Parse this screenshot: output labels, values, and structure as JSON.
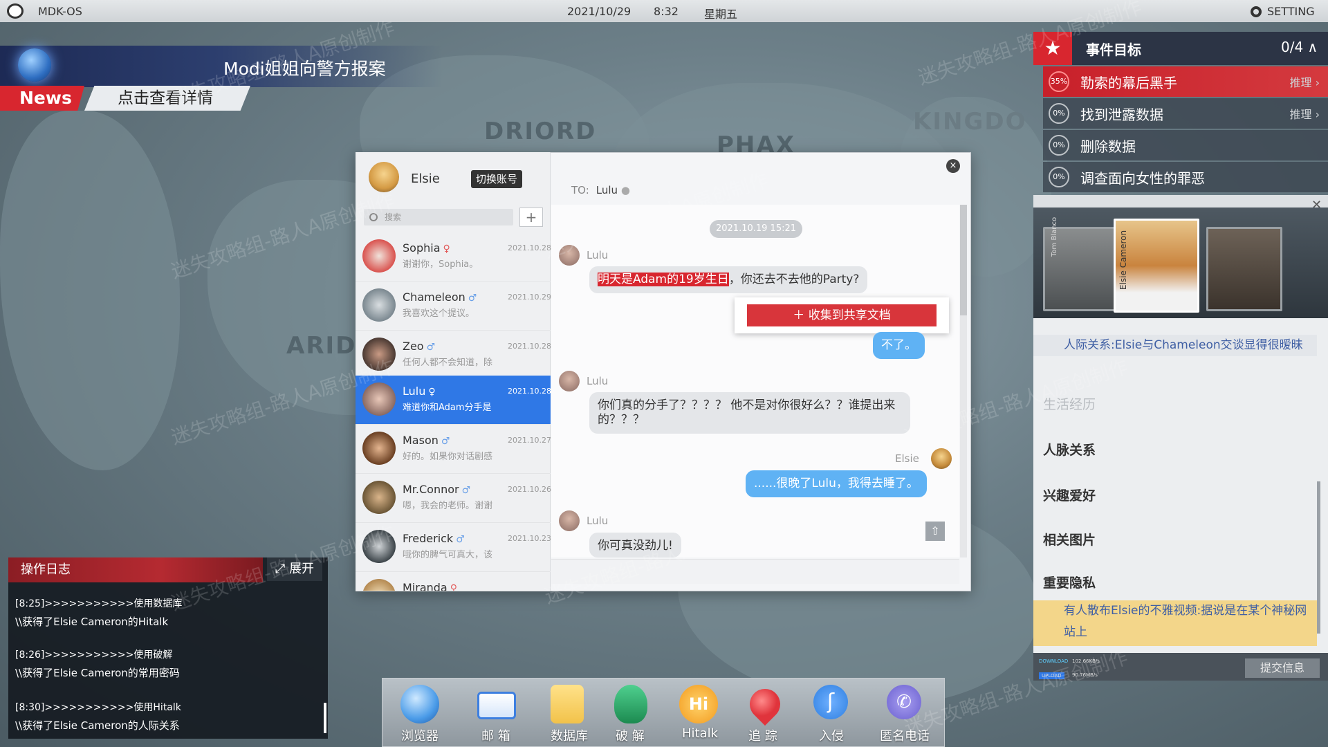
{
  "os": {
    "name": "MDK-OS",
    "date": "2021/10/29",
    "time": "8:32",
    "weekday": "星期五",
    "setting": "SETTING"
  },
  "map_labels": [
    "DRIORD",
    "PHAX",
    "ARID",
    "KINGDO"
  ],
  "watermark": "迷失攻略组-路人A原创制作",
  "news": {
    "headline": "Modi姐姐向警方报案",
    "tag": "News",
    "link": "点击查看详情"
  },
  "events": {
    "title": "事件目标",
    "count": "0/4",
    "items": [
      {
        "pct": "35%",
        "label": "勒索的幕后黑手",
        "action": "推理"
      },
      {
        "pct": "0%",
        "label": "找到泄露数据",
        "action": "推理"
      },
      {
        "pct": "0%",
        "label": "删除数据",
        "action": ""
      },
      {
        "pct": "0%",
        "label": "调查面向女性的罪恶",
        "action": ""
      }
    ]
  },
  "profile": {
    "card_names": [
      "Tom Blanco",
      "Elsie Cameron"
    ],
    "note1": "人际关系:Elsie与Chameleon交谈显得很暧昧",
    "sections": [
      "生活经历",
      "人脉关系",
      "兴趣爱好",
      "相关图片",
      "重要隐私"
    ],
    "note2": "有人散布Elsie的不雅视频:据说是在某个神秘网站上",
    "download": "DOWNLOAD",
    "upload": "UPLOAD",
    "download_speed": "102.66KB/s",
    "upload_speed": "90.76MB/s",
    "submit": "提交信息"
  },
  "chat": {
    "me": "Elsie",
    "switch_account": "切换账号",
    "search_placeholder": "搜索",
    "add": "+",
    "contacts": [
      {
        "name": "Sophia",
        "gender": "♀",
        "msg": "谢谢你，Sophia。",
        "date": "2021.10.28"
      },
      {
        "name": "Chameleon",
        "gender": "♂",
        "msg": "我喜欢这个提议。",
        "date": "2021.10.29"
      },
      {
        "name": "Zeo",
        "gender": "♂",
        "msg": "任何人都不会知道，除",
        "date": "2021.10.28"
      },
      {
        "name": "Lulu",
        "gender": "♀",
        "msg": "难道你和Adam分手是",
        "date": "2021.10.28"
      },
      {
        "name": "Mason",
        "gender": "♂",
        "msg": "好的。如果你对话剧感",
        "date": "2021.10.27"
      },
      {
        "name": "Mr.Connor",
        "gender": "♂",
        "msg": "嗯，我会的老师。谢谢",
        "date": "2021.10.26"
      },
      {
        "name": "Frederick",
        "gender": "♂",
        "msg": "哦你的脾气可真大，该",
        "date": "2021.10.23"
      },
      {
        "name": "Miranda",
        "gender": "♀",
        "msg": "",
        "date": ""
      }
    ],
    "to_label": "TO:",
    "to_name": "Lulu",
    "timestamp": "2021.10.19  15:21",
    "messages": [
      {
        "from": "Lulu",
        "highlight": "明天是Adam的19岁生日",
        "text": "，你还去不去他的Party?"
      },
      {
        "from": "Elsie",
        "text": "不了。"
      },
      {
        "from": "Lulu",
        "text": "你们真的分手了？？？？ 他不是对你很好么？？谁提出来的？？？"
      },
      {
        "from": "Elsie",
        "text": "......很晚了Lulu，我得去睡了。"
      },
      {
        "from": "Lulu",
        "text": "你可真没劲儿!"
      }
    ],
    "collect_button": "收集到共享文档",
    "close": "×"
  },
  "log": {
    "title": "操作日志",
    "expand": "展开",
    "entries": [
      {
        "action": "[8:25]>>>>>>>>>>>使用数据库",
        "result": "\\\\获得了Elsie Cameron的Hitalk"
      },
      {
        "action": "[8:26]>>>>>>>>>>>使用破解",
        "result": "\\\\获得了Elsie Cameron的常用密码"
      },
      {
        "action": "[8:30]>>>>>>>>>>>使用Hitalk",
        "result": "\\\\获得了Elsie Cameron的人际关系"
      }
    ]
  },
  "dock": [
    {
      "label": "浏览器",
      "icon": "globe-icon",
      "color": "#4a9be8"
    },
    {
      "label": "邮 箱",
      "icon": "mail-icon",
      "color": "#3d7fe0"
    },
    {
      "label": "数据库",
      "icon": "database-icon",
      "color": "#f2c24a"
    },
    {
      "label": "破 解",
      "icon": "unlock-icon",
      "color": "#27a866"
    },
    {
      "label": "Hitalk",
      "icon": "hitalk-icon",
      "color": "#f6a623"
    },
    {
      "label": "追 踪",
      "icon": "location-pin-icon",
      "color": "#e0343c"
    },
    {
      "label": "入侵",
      "icon": "hook-icon",
      "color": "#2f7fe0"
    },
    {
      "label": "匿名电话",
      "icon": "phone-icon",
      "color": "#7a6fd8"
    }
  ]
}
